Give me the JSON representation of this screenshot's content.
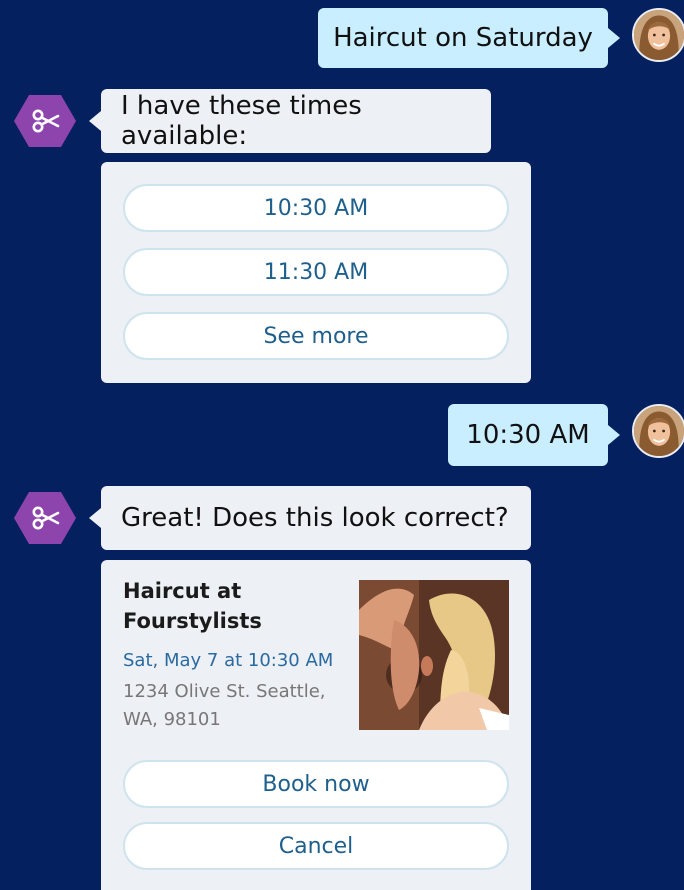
{
  "conversation": {
    "user_msg_1": "Haircut on Saturday",
    "bot_msg_1": "I have these times available:",
    "time_options": [
      "10:30 AM",
      "11:30 AM",
      "See more"
    ],
    "user_msg_2": "10:30 AM",
    "bot_msg_2": "Great! Does this look correct?"
  },
  "booking_card": {
    "title": "Haircut at Fourstylists",
    "datetime": "Sat, May 7 at 10:30 AM",
    "address": "1234 Olive St. Seattle, WA, 98101",
    "book_label": "Book now",
    "cancel_label": "Cancel"
  },
  "icons": {
    "bot_avatar": "scissors-icon",
    "user_avatar": "user-photo"
  },
  "colors": {
    "background": "#05205e",
    "user_bubble": "#c9eeff",
    "bot_bubble": "#edf0f5",
    "bot_avatar": "#8e44ad",
    "link": "#1f5f8b"
  }
}
